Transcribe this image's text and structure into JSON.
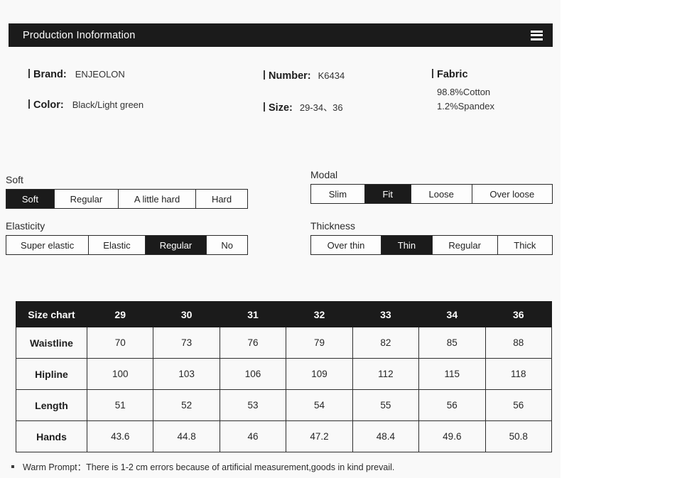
{
  "header": {
    "title": "Production Inoformation",
    "menu_icon": "hamburger-icon"
  },
  "specs": {
    "brand_label": "Brand:",
    "brand_value": "ENJEOLON",
    "color_label": "Color:",
    "color_value": "Black/Light green",
    "number_label": "Number:",
    "number_value": "K6434",
    "size_label": "Size:",
    "size_value": "29-34、36",
    "fabric_label": "Fabric",
    "fabric_line1": "98.8%Cotton",
    "fabric_line2": "1.2%Spandex"
  },
  "attributes": [
    {
      "key": "soft",
      "label": "Soft",
      "selected": "Soft",
      "options": [
        "Soft",
        "Regular",
        "A little hard",
        "Hard"
      ]
    },
    {
      "key": "modal",
      "label": "Modal",
      "selected": "Fit",
      "options": [
        "Slim",
        "Fit",
        "Loose",
        "Over loose"
      ]
    },
    {
      "key": "elasticity",
      "label": "Elasticity",
      "selected": "Regular",
      "options": [
        "Super elastic",
        "Elastic",
        "Regular",
        "No"
      ]
    },
    {
      "key": "thickness",
      "label": "Thickness",
      "selected": "Thin",
      "options": [
        "Over thin",
        "Thin",
        "Regular",
        "Thick"
      ]
    }
  ],
  "size_chart": {
    "corner_label": "Size chart",
    "sizes": [
      "29",
      "30",
      "31",
      "32",
      "33",
      "34",
      "36"
    ],
    "rows": [
      {
        "label": "Waistline",
        "values": [
          "70",
          "73",
          "76",
          "79",
          "82",
          "85",
          "88"
        ]
      },
      {
        "label": "Hipline",
        "values": [
          "100",
          "103",
          "106",
          "109",
          "112",
          "115",
          "118"
        ]
      },
      {
        "label": "Length",
        "values": [
          "51",
          "52",
          "53",
          "54",
          "55",
          "56",
          "56"
        ]
      },
      {
        "label": "Hands",
        "values": [
          "43.6",
          "44.8",
          "46",
          "47.2",
          "48.4",
          "49.6",
          "50.8"
        ]
      }
    ]
  },
  "footer": {
    "note": "Warm Prompt：There is 1-2 cm errors because of artificial measurement,goods in kind prevail."
  },
  "colors": {
    "accent": "#1b1b1b",
    "page_bg": "#f9f9f9",
    "border": "#2a2a2a"
  }
}
